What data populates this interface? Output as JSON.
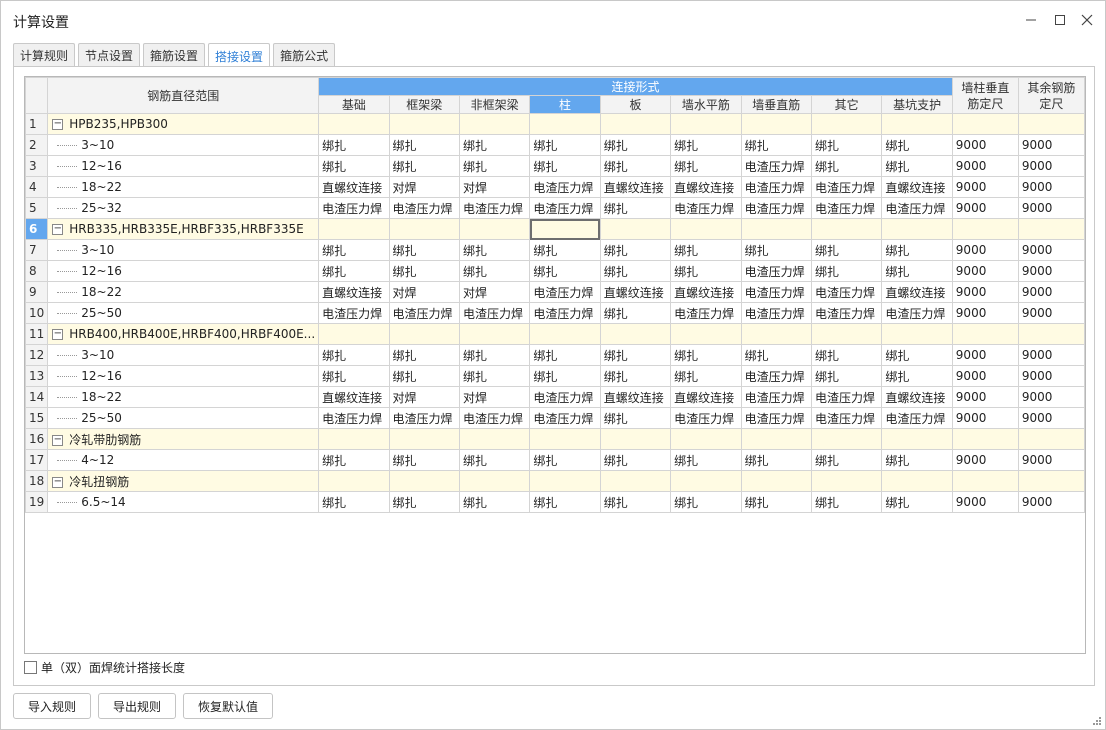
{
  "window": {
    "title": "计算设置"
  },
  "tabs": [
    {
      "label": "计算规则",
      "active": false
    },
    {
      "label": "节点设置",
      "active": false
    },
    {
      "label": "箍筋设置",
      "active": false
    },
    {
      "label": "搭接设置",
      "active": true
    },
    {
      "label": "箍筋公式",
      "active": false
    }
  ],
  "grid": {
    "name_header": "钢筋直径范围",
    "group_header": "连接形式",
    "columns": [
      "基础",
      "框架梁",
      "非框架梁",
      "柱",
      "板",
      "墙水平筋",
      "墙垂直筋",
      "其它",
      "基坑支护"
    ],
    "selected_column": 3,
    "extra_headers": [
      "墙柱垂直筋定尺",
      "其余钢筋定尺"
    ],
    "rows": [
      {
        "num": "1",
        "type": "group",
        "name": "HPB235,HPB300"
      },
      {
        "num": "2",
        "type": "item",
        "name": "3~10",
        "values": [
          "绑扎",
          "绑扎",
          "绑扎",
          "绑扎",
          "绑扎",
          "绑扎",
          "绑扎",
          "绑扎",
          "绑扎",
          "9000",
          "9000"
        ]
      },
      {
        "num": "3",
        "type": "item",
        "name": "12~16",
        "values": [
          "绑扎",
          "绑扎",
          "绑扎",
          "绑扎",
          "绑扎",
          "绑扎",
          "电渣压力焊",
          "绑扎",
          "绑扎",
          "9000",
          "9000"
        ]
      },
      {
        "num": "4",
        "type": "item",
        "name": "18~22",
        "values": [
          "直螺纹连接",
          "对焊",
          "对焊",
          "电渣压力焊",
          "直螺纹连接",
          "直螺纹连接",
          "电渣压力焊",
          "电渣压力焊",
          "直螺纹连接",
          "9000",
          "9000"
        ]
      },
      {
        "num": "5",
        "type": "item",
        "name": "25~32",
        "values": [
          "电渣压力焊",
          "电渣压力焊",
          "电渣压力焊",
          "电渣压力焊",
          "绑扎",
          "电渣压力焊",
          "电渣压力焊",
          "电渣压力焊",
          "电渣压力焊",
          "9000",
          "9000"
        ]
      },
      {
        "num": "6",
        "type": "group",
        "name": "HRB335,HRB335E,HRBF335,HRBF335E",
        "active": true
      },
      {
        "num": "7",
        "type": "item",
        "name": "3~10",
        "values": [
          "绑扎",
          "绑扎",
          "绑扎",
          "绑扎",
          "绑扎",
          "绑扎",
          "绑扎",
          "绑扎",
          "绑扎",
          "9000",
          "9000"
        ]
      },
      {
        "num": "8",
        "type": "item",
        "name": "12~16",
        "values": [
          "绑扎",
          "绑扎",
          "绑扎",
          "绑扎",
          "绑扎",
          "绑扎",
          "电渣压力焊",
          "绑扎",
          "绑扎",
          "9000",
          "9000"
        ]
      },
      {
        "num": "9",
        "type": "item",
        "name": "18~22",
        "values": [
          "直螺纹连接",
          "对焊",
          "对焊",
          "电渣压力焊",
          "直螺纹连接",
          "直螺纹连接",
          "电渣压力焊",
          "电渣压力焊",
          "直螺纹连接",
          "9000",
          "9000"
        ]
      },
      {
        "num": "10",
        "type": "item",
        "name": "25~50",
        "values": [
          "电渣压力焊",
          "电渣压力焊",
          "电渣压力焊",
          "电渣压力焊",
          "绑扎",
          "电渣压力焊",
          "电渣压力焊",
          "电渣压力焊",
          "电渣压力焊",
          "9000",
          "9000"
        ]
      },
      {
        "num": "11",
        "type": "group",
        "name": "HRB400,HRB400E,HRBF400,HRBF400E..."
      },
      {
        "num": "12",
        "type": "item",
        "name": "3~10",
        "values": [
          "绑扎",
          "绑扎",
          "绑扎",
          "绑扎",
          "绑扎",
          "绑扎",
          "绑扎",
          "绑扎",
          "绑扎",
          "9000",
          "9000"
        ]
      },
      {
        "num": "13",
        "type": "item",
        "name": "12~16",
        "values": [
          "绑扎",
          "绑扎",
          "绑扎",
          "绑扎",
          "绑扎",
          "绑扎",
          "电渣压力焊",
          "绑扎",
          "绑扎",
          "9000",
          "9000"
        ]
      },
      {
        "num": "14",
        "type": "item",
        "name": "18~22",
        "values": [
          "直螺纹连接",
          "对焊",
          "对焊",
          "电渣压力焊",
          "直螺纹连接",
          "直螺纹连接",
          "电渣压力焊",
          "电渣压力焊",
          "直螺纹连接",
          "9000",
          "9000"
        ]
      },
      {
        "num": "15",
        "type": "item",
        "name": "25~50",
        "values": [
          "电渣压力焊",
          "电渣压力焊",
          "电渣压力焊",
          "电渣压力焊",
          "绑扎",
          "电渣压力焊",
          "电渣压力焊",
          "电渣压力焊",
          "电渣压力焊",
          "9000",
          "9000"
        ]
      },
      {
        "num": "16",
        "type": "group",
        "name": "冷轧带肋钢筋"
      },
      {
        "num": "17",
        "type": "item",
        "name": "4~12",
        "values": [
          "绑扎",
          "绑扎",
          "绑扎",
          "绑扎",
          "绑扎",
          "绑扎",
          "绑扎",
          "绑扎",
          "绑扎",
          "9000",
          "9000"
        ]
      },
      {
        "num": "18",
        "type": "group",
        "name": "冷轧扭钢筋"
      },
      {
        "num": "19",
        "type": "item",
        "name": "6.5~14",
        "values": [
          "绑扎",
          "绑扎",
          "绑扎",
          "绑扎",
          "绑扎",
          "绑扎",
          "绑扎",
          "绑扎",
          "绑扎",
          "9000",
          "9000"
        ]
      }
    ]
  },
  "footer": {
    "checkbox_label": "单（双）面焊统计搭接长度",
    "checkbox_checked": false
  },
  "buttons": {
    "import": "导入规则",
    "export": "导出规则",
    "restore": "恢复默认值"
  },
  "toggle_symbol": "−",
  "colors": {
    "accent": "#63a7ee",
    "group_row_bg": "#fffbe3",
    "active_tab_text": "#2f7fd6"
  }
}
